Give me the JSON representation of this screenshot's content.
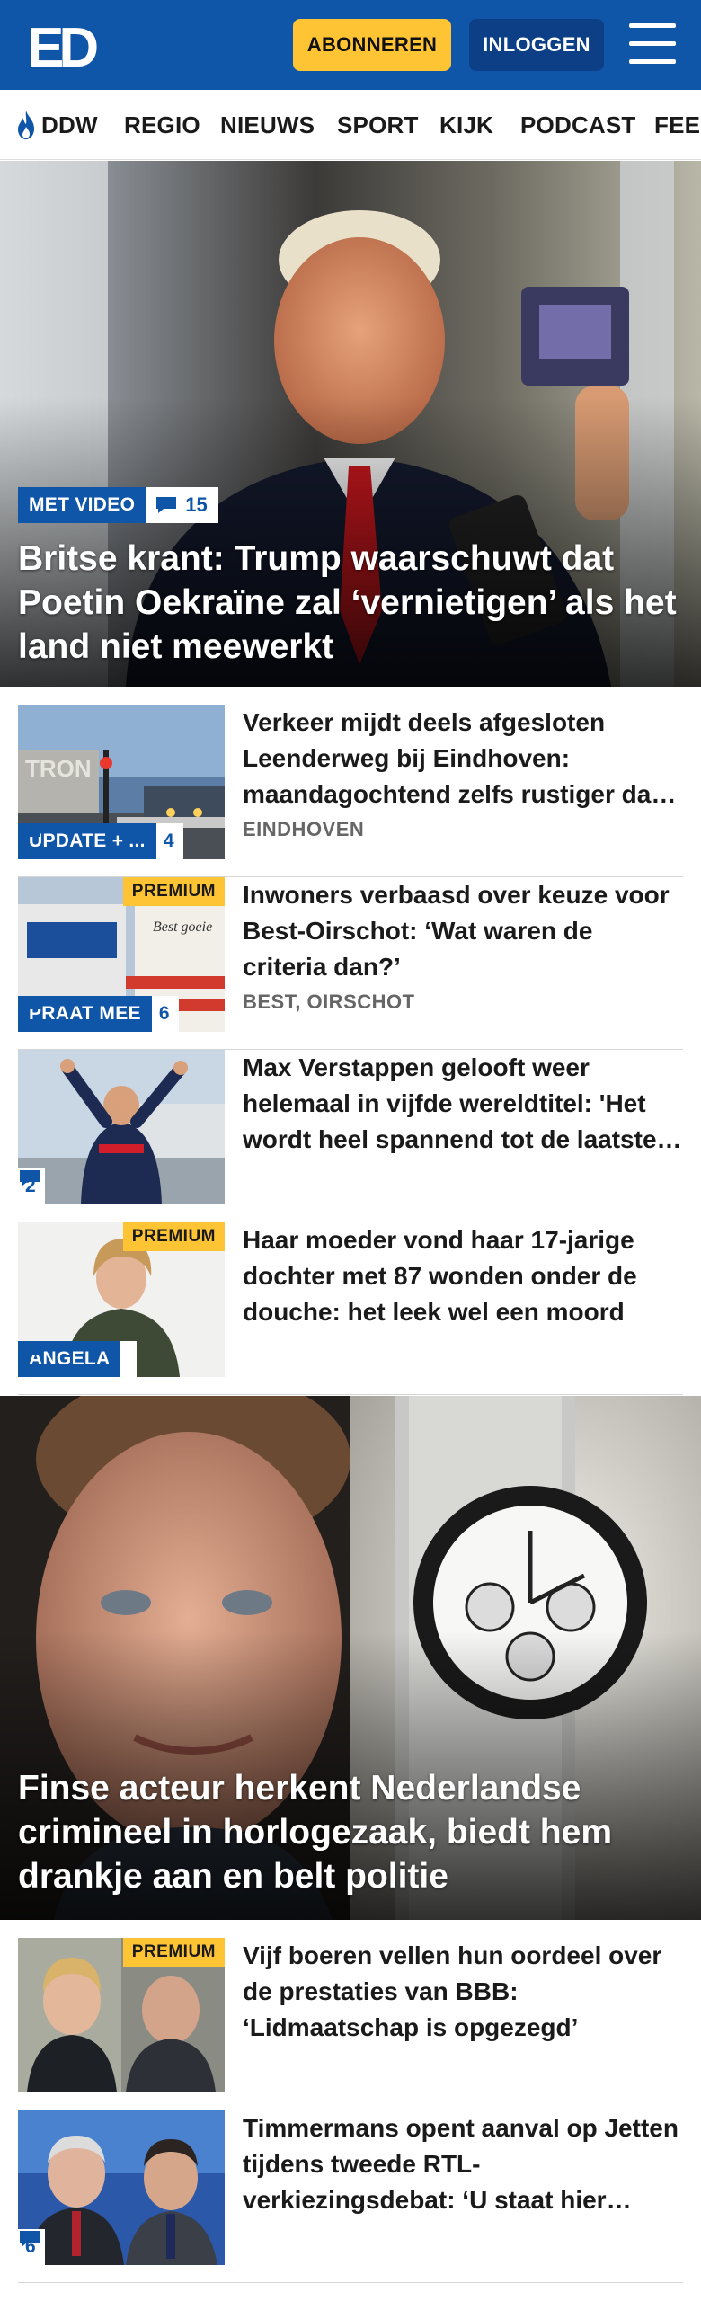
{
  "header": {
    "logo_text": "ED",
    "subscribe_label": "ABONNEREN",
    "login_label": "INLOGGEN"
  },
  "nav": {
    "items": [
      "DDW",
      "REGIO",
      "NIEUWS",
      "SPORT",
      "KIJK",
      "PODCAST",
      "FEE"
    ]
  },
  "hero1": {
    "badge": "MET VIDEO",
    "comments": "15",
    "title": "Britse krant: Trump waarschuwt dat Poetin Oekraïne zal ‘vernietigen’ als het land niet meewerkt"
  },
  "articles": [
    {
      "tag": "UPDATE + ...",
      "comments": "4",
      "premium": "",
      "title": "Verkeer mijdt deels afgesloten Leenderweg bij Eindhoven: maandagochtend zelfs rustiger dan normaal",
      "meta": "EINDHOVEN"
    },
    {
      "tag": "PRAAT MEE",
      "comments": "6",
      "premium": "PREMIUM",
      "title": "Inwoners verbaasd over keuze voor Best-Oirschot: ‘Wat waren de criteria dan?’",
      "meta": "BEST, OIRSCHOT"
    },
    {
      "tag": "",
      "comments": "2",
      "premium": "",
      "title": "Max Verstappen gelooft weer helemaal in vijfde wereldtitel: 'Het wordt heel spannend tot de laatste race'",
      "meta": ""
    },
    {
      "tag": "ANGELA",
      "comments": "",
      "premium": "PREMIUM",
      "title": "Haar moeder vond haar 17-jarige dochter met 87 wonden onder de douche: het leek wel een moord",
      "meta": ""
    }
  ],
  "hero2": {
    "title": "Finse acteur herkent Nederlandse crimineel in horlogezaak, biedt hem drankje aan en belt politie"
  },
  "articles2": [
    {
      "tag": "",
      "comments": "",
      "premium": "PREMIUM",
      "title": "Vijf boeren vellen hun oordeel over de prestaties van BBB: ‘Lidmaatschap is opgezegd’",
      "meta": ""
    },
    {
      "tag": "",
      "comments": "6",
      "premium": "",
      "title": "Timmermans opent aanval op Jetten tijdens tweede RTL-verkiezingsdebat: ‘U staat hier namens de VVD’",
      "meta": ""
    }
  ],
  "colors": {
    "brand_blue": "#0f55a8",
    "accent_yellow": "#fec434",
    "login_blue": "#0c3f86"
  },
  "icons": [
    "hamburger-menu-icon",
    "flame-icon",
    "comment-bubble-icon"
  ]
}
